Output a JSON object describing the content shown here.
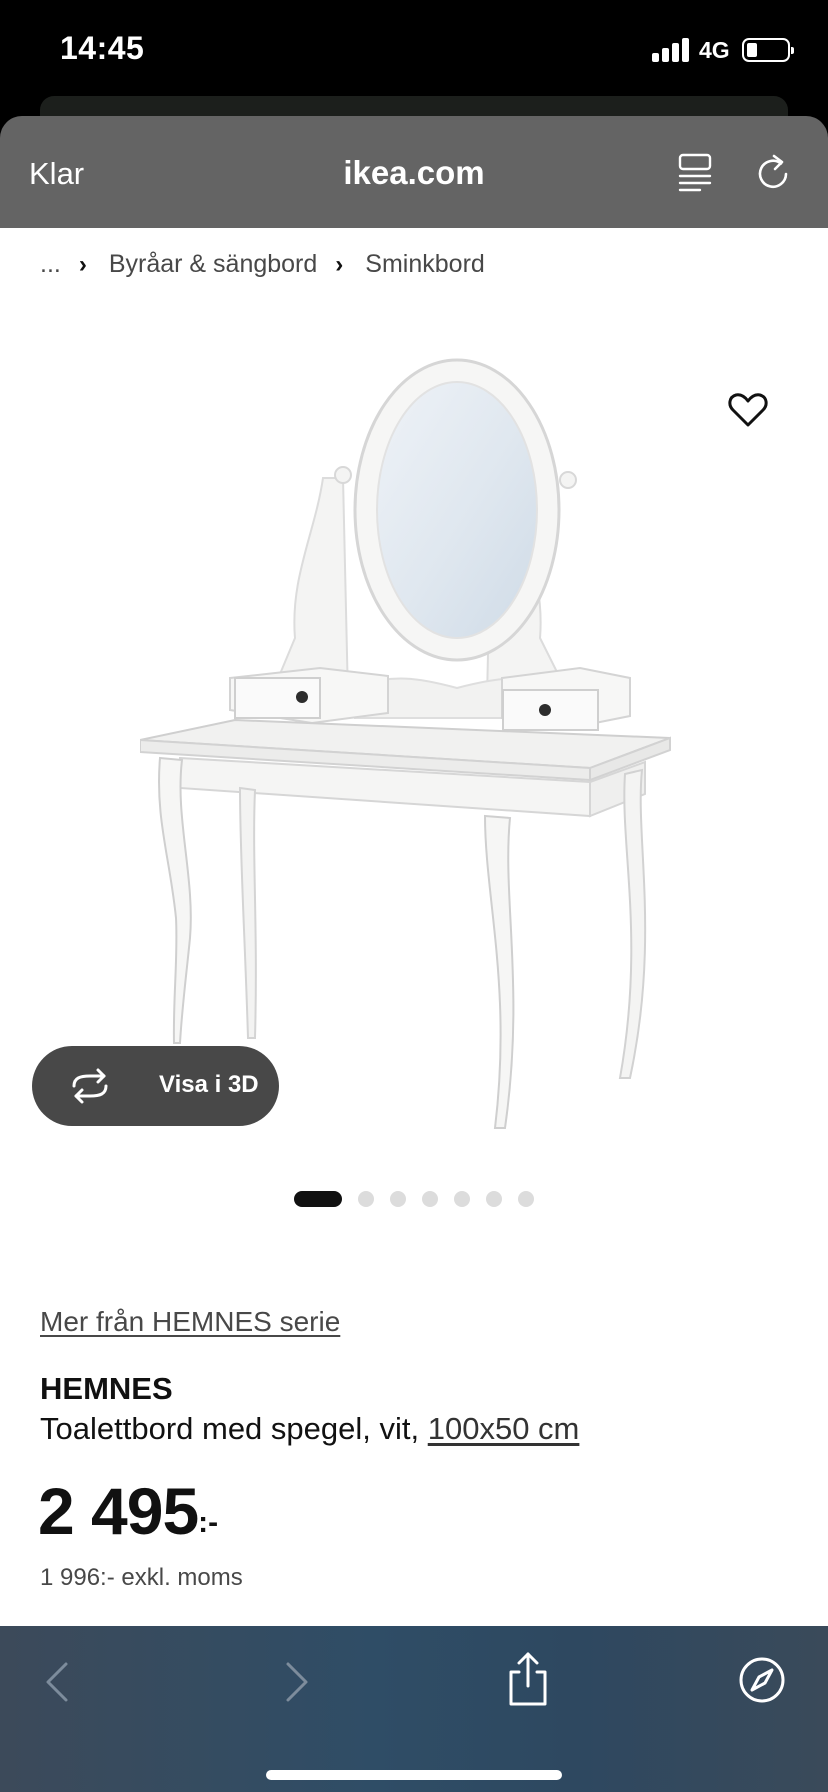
{
  "status_bar": {
    "time": "14:45",
    "network": "4G"
  },
  "browser": {
    "done_label": "Klar",
    "url": "ikea.com"
  },
  "breadcrumb": {
    "items": [
      "...",
      "Byråar & sängbord",
      "Sminkbord"
    ]
  },
  "product": {
    "view_3d_label": "Visa i 3D",
    "image_count": 7,
    "active_image": 1,
    "series_link": "Mer från HEMNES serie",
    "name": "HEMNES",
    "description": "Toalettbord med spegel, vit,",
    "size": "100x50 cm",
    "price": "2 495",
    "price_suffix": ":-",
    "price_excl_vat": "1 996:- exkl. moms"
  },
  "icons": {
    "reader": "reader-view-icon",
    "reload": "reload-icon",
    "favorite": "heart-icon",
    "rotate": "rotate-3d-icon",
    "back": "chevron-left-icon",
    "forward": "chevron-right-icon",
    "share": "share-icon",
    "safari": "compass-icon"
  }
}
